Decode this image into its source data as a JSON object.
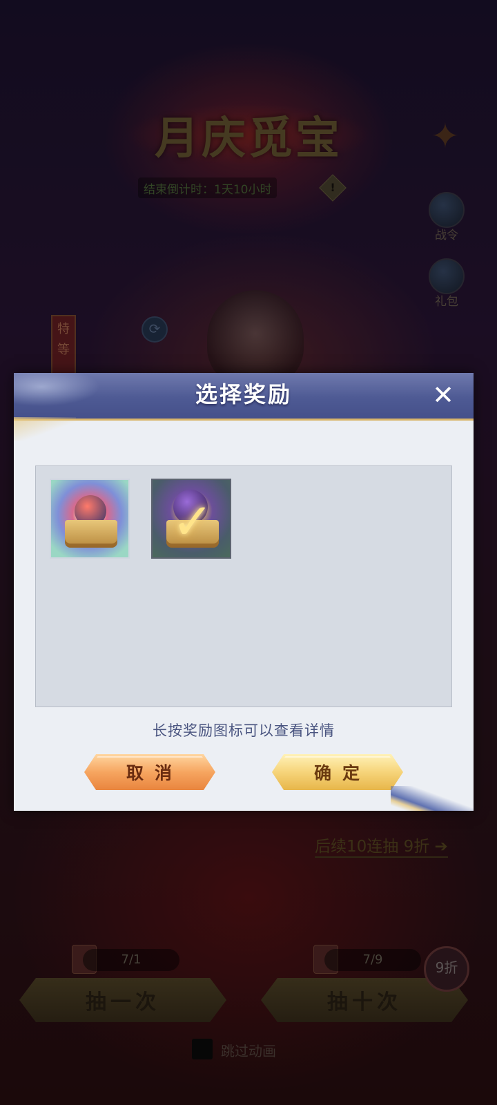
{
  "background": {
    "event_title": "月庆觅宝",
    "countdown": "结束倒计时：1天10小时",
    "countdown_info_glyph": "!",
    "side_icons": [
      {
        "label": "战令",
        "icon": "battle-pass-icon"
      },
      {
        "label": "礼包",
        "icon": "gift-pack-icon"
      }
    ],
    "special_tag": "特等",
    "discount_link": "后续10连抽 9折 ➔",
    "draw_one": {
      "counter": "7/1",
      "label": "抽一次"
    },
    "draw_ten": {
      "counter": "7/9",
      "label": "抽十次",
      "badge": "9折"
    },
    "skip_label": "跳过动画"
  },
  "dialog": {
    "title": "选择奖励",
    "close_glyph": "✕",
    "rewards": [
      {
        "icon": "reward-chest-icon",
        "selected": false
      },
      {
        "icon": "reward-chest-selected-icon",
        "selected": true,
        "check_glyph": "✓"
      }
    ],
    "hint": "长按奖励图标可以查看详情",
    "cancel_label": "取消",
    "confirm_label": "确定"
  },
  "colors": {
    "header": "#4e5a94",
    "panel": "#d6dbe3",
    "cancel": "#f6a560",
    "confirm": "#f6d47a",
    "hint": "#4a5580"
  }
}
